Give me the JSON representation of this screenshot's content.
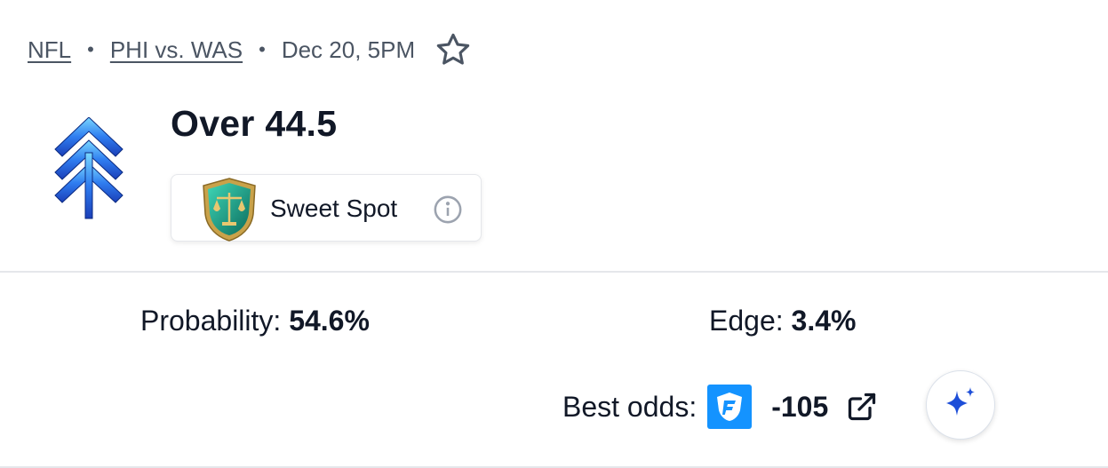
{
  "breadcrumb": {
    "league": "NFL",
    "matchup": "PHI vs. WAS",
    "datetime": "Dec 20, 5PM",
    "separator": "•"
  },
  "icons": {
    "favorite": "star-icon",
    "info": "info-icon",
    "external": "external-link-icon",
    "ai": "sparkle-icon",
    "pick_logo": "chevron-arrows-up-icon",
    "badge": "scales-shield-icon",
    "sportsbook": "fanduel-shield-icon"
  },
  "pick": {
    "title": "Over 44.5",
    "badge_label": "Sweet Spot"
  },
  "stats": {
    "probability_label": "Probability:",
    "probability_value": "54.6%",
    "edge_label": "Edge:",
    "edge_value": "3.4%"
  },
  "odds": {
    "best_label": "Best odds:",
    "value": "-105"
  },
  "colors": {
    "accent_blue": "#1d4ed8",
    "sportsbook_blue": "#1493ff",
    "text": "#111827",
    "muted": "#4b5563",
    "badge_teal": "#0f8a78",
    "badge_gold": "#c9a24a"
  }
}
